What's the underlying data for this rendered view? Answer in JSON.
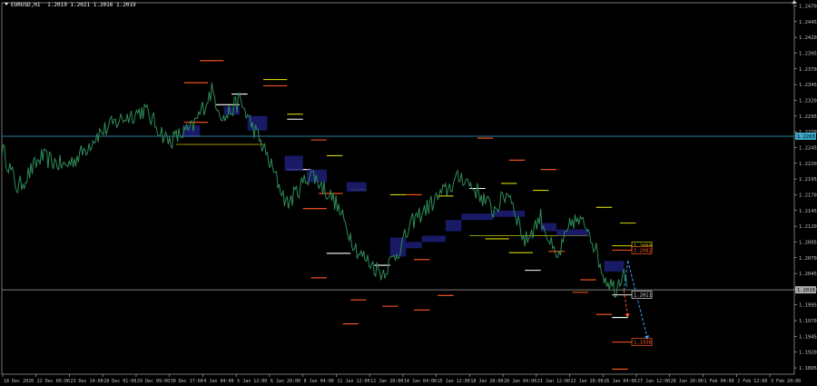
{
  "chart": {
    "symbol": "EURUSD,H1",
    "ohlc": "1.2019 1.2021 1.2016 1.2019",
    "bg": "#000000",
    "price_line_color": "#2e8b57",
    "axis_color": "#c0c0c0"
  },
  "price_axis": {
    "min": 1.1885,
    "max": 1.2475,
    "labels": [
      "1.2470",
      "1.2445",
      "1.2420",
      "1.2395",
      "1.2370",
      "1.2345",
      "1.2320",
      "1.2295",
      "1.2270",
      "1.2245",
      "1.2220",
      "1.2195",
      "1.2170",
      "1.2145",
      "1.2120",
      "1.2095",
      "1.2070",
      "1.2045",
      "1.2020",
      "1.1995",
      "1.1970",
      "1.1945",
      "1.1920",
      "1.1895"
    ]
  },
  "time_axis": {
    "labels": [
      "18 Dec 2020",
      "22 Dec 06:00",
      "23 Dec 14:00",
      "28 Dec 01:00",
      "29 Dec 09:00",
      "30 Dec 17:00",
      "4 Jan 04:00",
      "5 Jan 12:00",
      "6 Jan 20:00",
      "8 Jan 04:00",
      "11 Jan 12:00",
      "12 Jan 20:00",
      "14 Jan 04:00",
      "15 Jan 12:00",
      "18 Jan 20:00",
      "20 Jan 04:00",
      "21 Jan 12:00",
      "22 Jan 20:00",
      "26 Jan 04:00",
      "27 Jan 12:00",
      "28 Jan 20:00",
      "1 Feb 04:00",
      "2 Feb 12:00",
      "3 Feb 20:00"
    ]
  },
  "horizontal_lines": [
    {
      "price": 1.2263,
      "color": "#3ba7c9",
      "label": "1.2263"
    },
    {
      "price": 1.2019,
      "color": "#a8a8a8",
      "label": "1.2019"
    }
  ],
  "price_tags": [
    {
      "price": 1.2089,
      "label": "1.2089",
      "bg": "#000000",
      "border": "#d4d400",
      "color": "#d4d400"
    },
    {
      "price": 1.2082,
      "label": "1.2082",
      "bg": "#000000",
      "border": "#ff5a1f",
      "color": "#ff5a1f"
    },
    {
      "price": 1.2011,
      "label": "1.2011",
      "bg": "#000000",
      "border": "#dddddd",
      "color": "#dddddd"
    },
    {
      "price": 1.1936,
      "label": "1.1936",
      "bg": "#000000",
      "border": "#ff5a1f",
      "color": "#ff5a1f"
    }
  ],
  "projections": [
    {
      "from": [
        0.79,
        1.2065
      ],
      "to": [
        0.815,
        1.194
      ],
      "color": "#3aa0ff"
    },
    {
      "from": [
        0.785,
        1.2018
      ],
      "to": [
        0.79,
        1.1975
      ],
      "color": "#ff5a1f"
    }
  ]
}
